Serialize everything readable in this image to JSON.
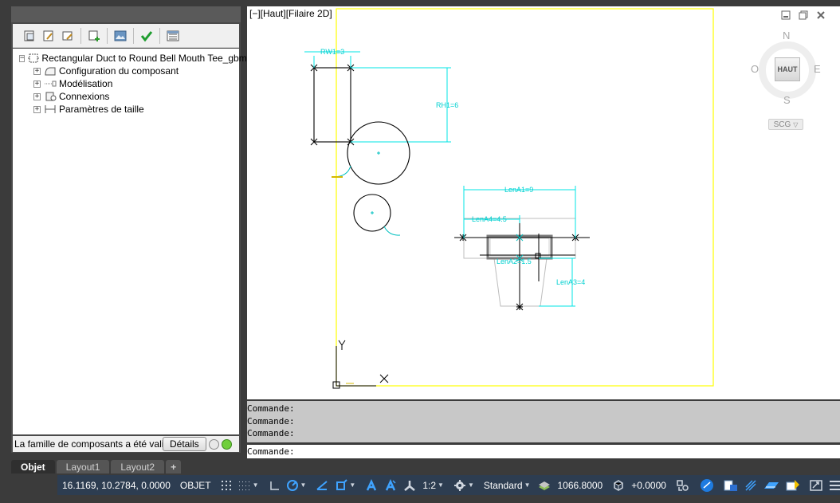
{
  "palette": {
    "tree": {
      "root": "Rectangular Duct to Round Bell Mouth Tee_gbm",
      "items": [
        {
          "label": "Configuration du composant",
          "icon": "config-icon"
        },
        {
          "label": "Modélisation",
          "icon": "modeling-icon"
        },
        {
          "label": "Connexions",
          "icon": "connections-icon"
        },
        {
          "label": "Paramètres de taille",
          "icon": "size-parameters-icon"
        }
      ]
    },
    "status": {
      "message": "La famille de composants a été validée",
      "details_label": "Détails",
      "indicator_colors": [
        "#e8e8e8",
        "#6fcf3a"
      ]
    }
  },
  "viewport": {
    "label": "[−][Haut][Filaire 2D]",
    "viewcube": {
      "north": "N",
      "south": "S",
      "east": "E",
      "west": "O",
      "face": "HAUT",
      "ucs": "SCG"
    },
    "dimensions": {
      "rw1": "RW1=3",
      "rh1": "RH1=6",
      "lena1": "LenA1=9",
      "lena4": "LenA4=4.5",
      "lena2": "LenA2=1.5",
      "lena3": "LenA3=4"
    },
    "axes": {
      "x": "X",
      "y": "Y"
    }
  },
  "command": {
    "history": [
      "Commande:",
      "Commande:",
      "Commande:"
    ],
    "prompt": "Commande:",
    "input_value": ""
  },
  "tabs": [
    {
      "label": "Objet",
      "active": true
    },
    {
      "label": "Layout1",
      "active": false
    },
    {
      "label": "Layout2",
      "active": false
    },
    {
      "label": "+",
      "active": false
    }
  ],
  "statusbar": {
    "coordinates": "16.1169, 10.2784, 0.0000",
    "mode": "OBJET",
    "scale": "1:2",
    "style": "Standard",
    "elevation": "1066.8000",
    "offset": "+0.0000"
  },
  "colors": {
    "dimension": "#00e5e5",
    "boundary": "#ffff00",
    "geometry": "#000000",
    "status_bar": "#2d3d51"
  }
}
